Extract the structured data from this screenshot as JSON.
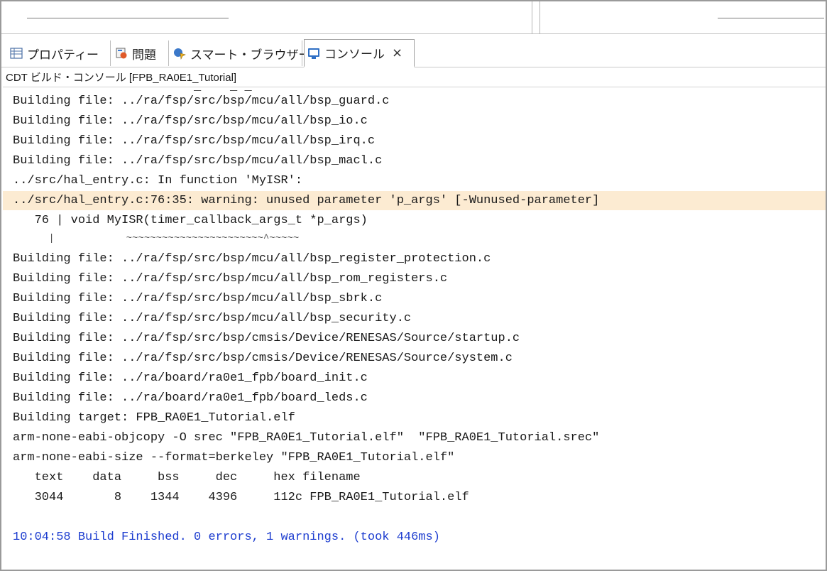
{
  "tabs": [
    {
      "label": "プロパティー",
      "icon": "properties-icon"
    },
    {
      "label": "問題",
      "icon": "problems-icon"
    },
    {
      "label": "スマート・ブラウザー",
      "icon": "smart-browser-icon"
    },
    {
      "label": "コンソール",
      "icon": "console-icon",
      "close": "×"
    }
  ],
  "console_title": "CDT ビルド・コンソール [FPB_RA0E1_Tutorial]",
  "lines": [
    "Building file: ../ra/fsp/src/bsp/mcu/all/bsp_guard.c",
    "Building file: ../ra/fsp/src/bsp/mcu/all/bsp_io.c",
    "Building file: ../ra/fsp/src/bsp/mcu/all/bsp_irq.c",
    "Building file: ../ra/fsp/src/bsp/mcu/all/bsp_macl.c",
    "../src/hal_entry.c: In function 'MyISR':",
    "../src/hal_entry.c:76:35: warning: unused parameter 'p_args' [-Wunused-parameter]",
    "   76 | void MyISR(timer_callback_args_t *p_args)",
    "      |            ~~~~~~~~~~~~~~~~~~~~~~~^~~~~~",
    "Building file: ../ra/fsp/src/bsp/mcu/all/bsp_register_protection.c",
    "Building file: ../ra/fsp/src/bsp/mcu/all/bsp_rom_registers.c",
    "Building file: ../ra/fsp/src/bsp/mcu/all/bsp_sbrk.c",
    "Building file: ../ra/fsp/src/bsp/mcu/all/bsp_security.c",
    "Building file: ../ra/fsp/src/bsp/cmsis/Device/RENESAS/Source/startup.c",
    "Building file: ../ra/fsp/src/bsp/cmsis/Device/RENESAS/Source/system.c",
    "Building file: ../ra/board/ra0e1_fpb/board_init.c",
    "Building file: ../ra/board/ra0e1_fpb/board_leds.c",
    "Building target: FPB_RA0E1_Tutorial.elf",
    "arm-none-eabi-objcopy -O srec \"FPB_RA0E1_Tutorial.elf\"  \"FPB_RA0E1_Tutorial.srec\"",
    "arm-none-eabi-size --format=berkeley \"FPB_RA0E1_Tutorial.elf\"",
    "   text    data     bss     dec     hex filename",
    "   3044       8    1344    4396     112c FPB_RA0E1_Tutorial.elf",
    "",
    "10:04:58 Build Finished. 0 errors, 1 warnings. (took 446ms)"
  ],
  "colors": {
    "warning_highlight": "#fcebd2",
    "finished_text": "#1c3ccf"
  }
}
